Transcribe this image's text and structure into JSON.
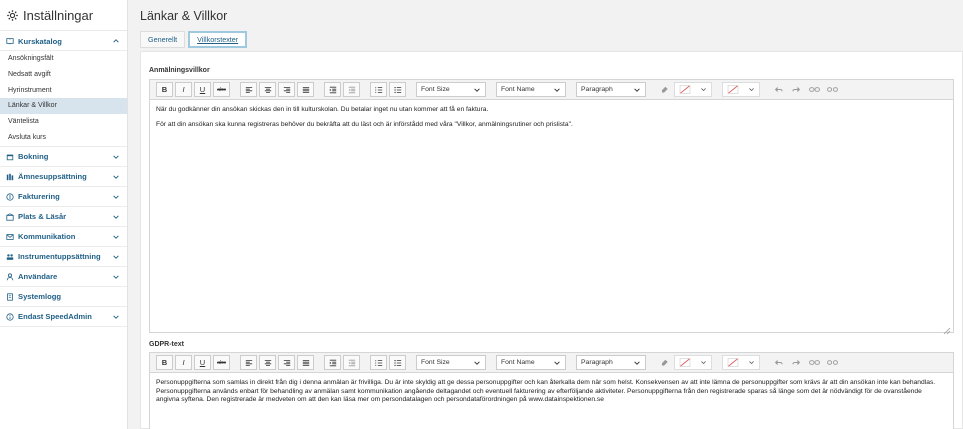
{
  "sidebar": {
    "title": "Inställningar",
    "open_section": {
      "label": "Kurskatalog",
      "icon": "book-open-icon",
      "items": [
        "Ansökningsfält",
        "Nedsatt avgift",
        "Hyrinstrument",
        "Länkar & Villkor",
        "Väntelista",
        "Avsluta kurs"
      ],
      "active_item": "Länkar & Villkor"
    },
    "sections": [
      {
        "label": "Bokning",
        "icon": "calendar-icon",
        "chevron": true
      },
      {
        "label": "Ämnesuppsättning",
        "icon": "books-icon",
        "chevron": true
      },
      {
        "label": "Fakturering",
        "icon": "dollar-circle-icon",
        "chevron": true
      },
      {
        "label": "Plats & Läsår",
        "icon": "building-icon",
        "chevron": true
      },
      {
        "label": "Kommunikation",
        "icon": "envelope-icon",
        "chevron": true
      },
      {
        "label": "Instrumentuppsättning",
        "icon": "instruments-icon",
        "chevron": true
      },
      {
        "label": "Användare",
        "icon": "user-icon",
        "chevron": true
      },
      {
        "label": "Systemlogg",
        "icon": "log-icon",
        "chevron": false
      },
      {
        "label": "Endast SpeedAdmin",
        "icon": "info-circle-icon",
        "chevron": true
      }
    ]
  },
  "main": {
    "title": "Länkar & Villkor",
    "tabs": [
      {
        "label": "Generellt",
        "active": false
      },
      {
        "label": "Villkorstexter",
        "active": true
      }
    ]
  },
  "toolbar": {
    "bold": "B",
    "italic": "I",
    "underline": "U",
    "strike": "abc",
    "font_size": "Font Size",
    "font_name": "Font Name",
    "format": "Paragraph"
  },
  "editor1": {
    "label": "Anmälningsvillkor",
    "paragraphs": [
      "När du godkänner din ansökan skickas den in till kulturskolan. Du betalar inget nu utan kommer att få en faktura.",
      "För att din ansökan ska kunna registreras behöver du bekräfta att du läst och är införstådd med våra \"Villkor, anmälningsrutiner och prislista\"."
    ]
  },
  "editor2": {
    "label": "GDPR-text",
    "paragraphs": [
      "Personuppgifterna som samlas in direkt från dig i denna anmälan är frivilliga. Du är inte skyldig att ge dessa personuppgifter och kan återkalla dem när som helst. Konsekvensen av att inte lämna de personuppgifter som krävs är att din ansökan inte kan behandlas. Personuppgifterna används enbart för behandling av anmälan samt kommunikation angående deltagandet och eventuell fakturering av efterföljande aktiviteter. Personuppgifterna från den registrerade sparas så länge som det är nödvändigt för de ovanstående angivna syftena. Den registrerade är medveten om att den kan läsa mer om persondatalagen och persondataförordningen på www.datainspektionen.se"
    ]
  },
  "colors": {
    "accent": "#1f5f86",
    "active_bg": "#d7e4ee",
    "tab_border": "#9ec9df"
  }
}
